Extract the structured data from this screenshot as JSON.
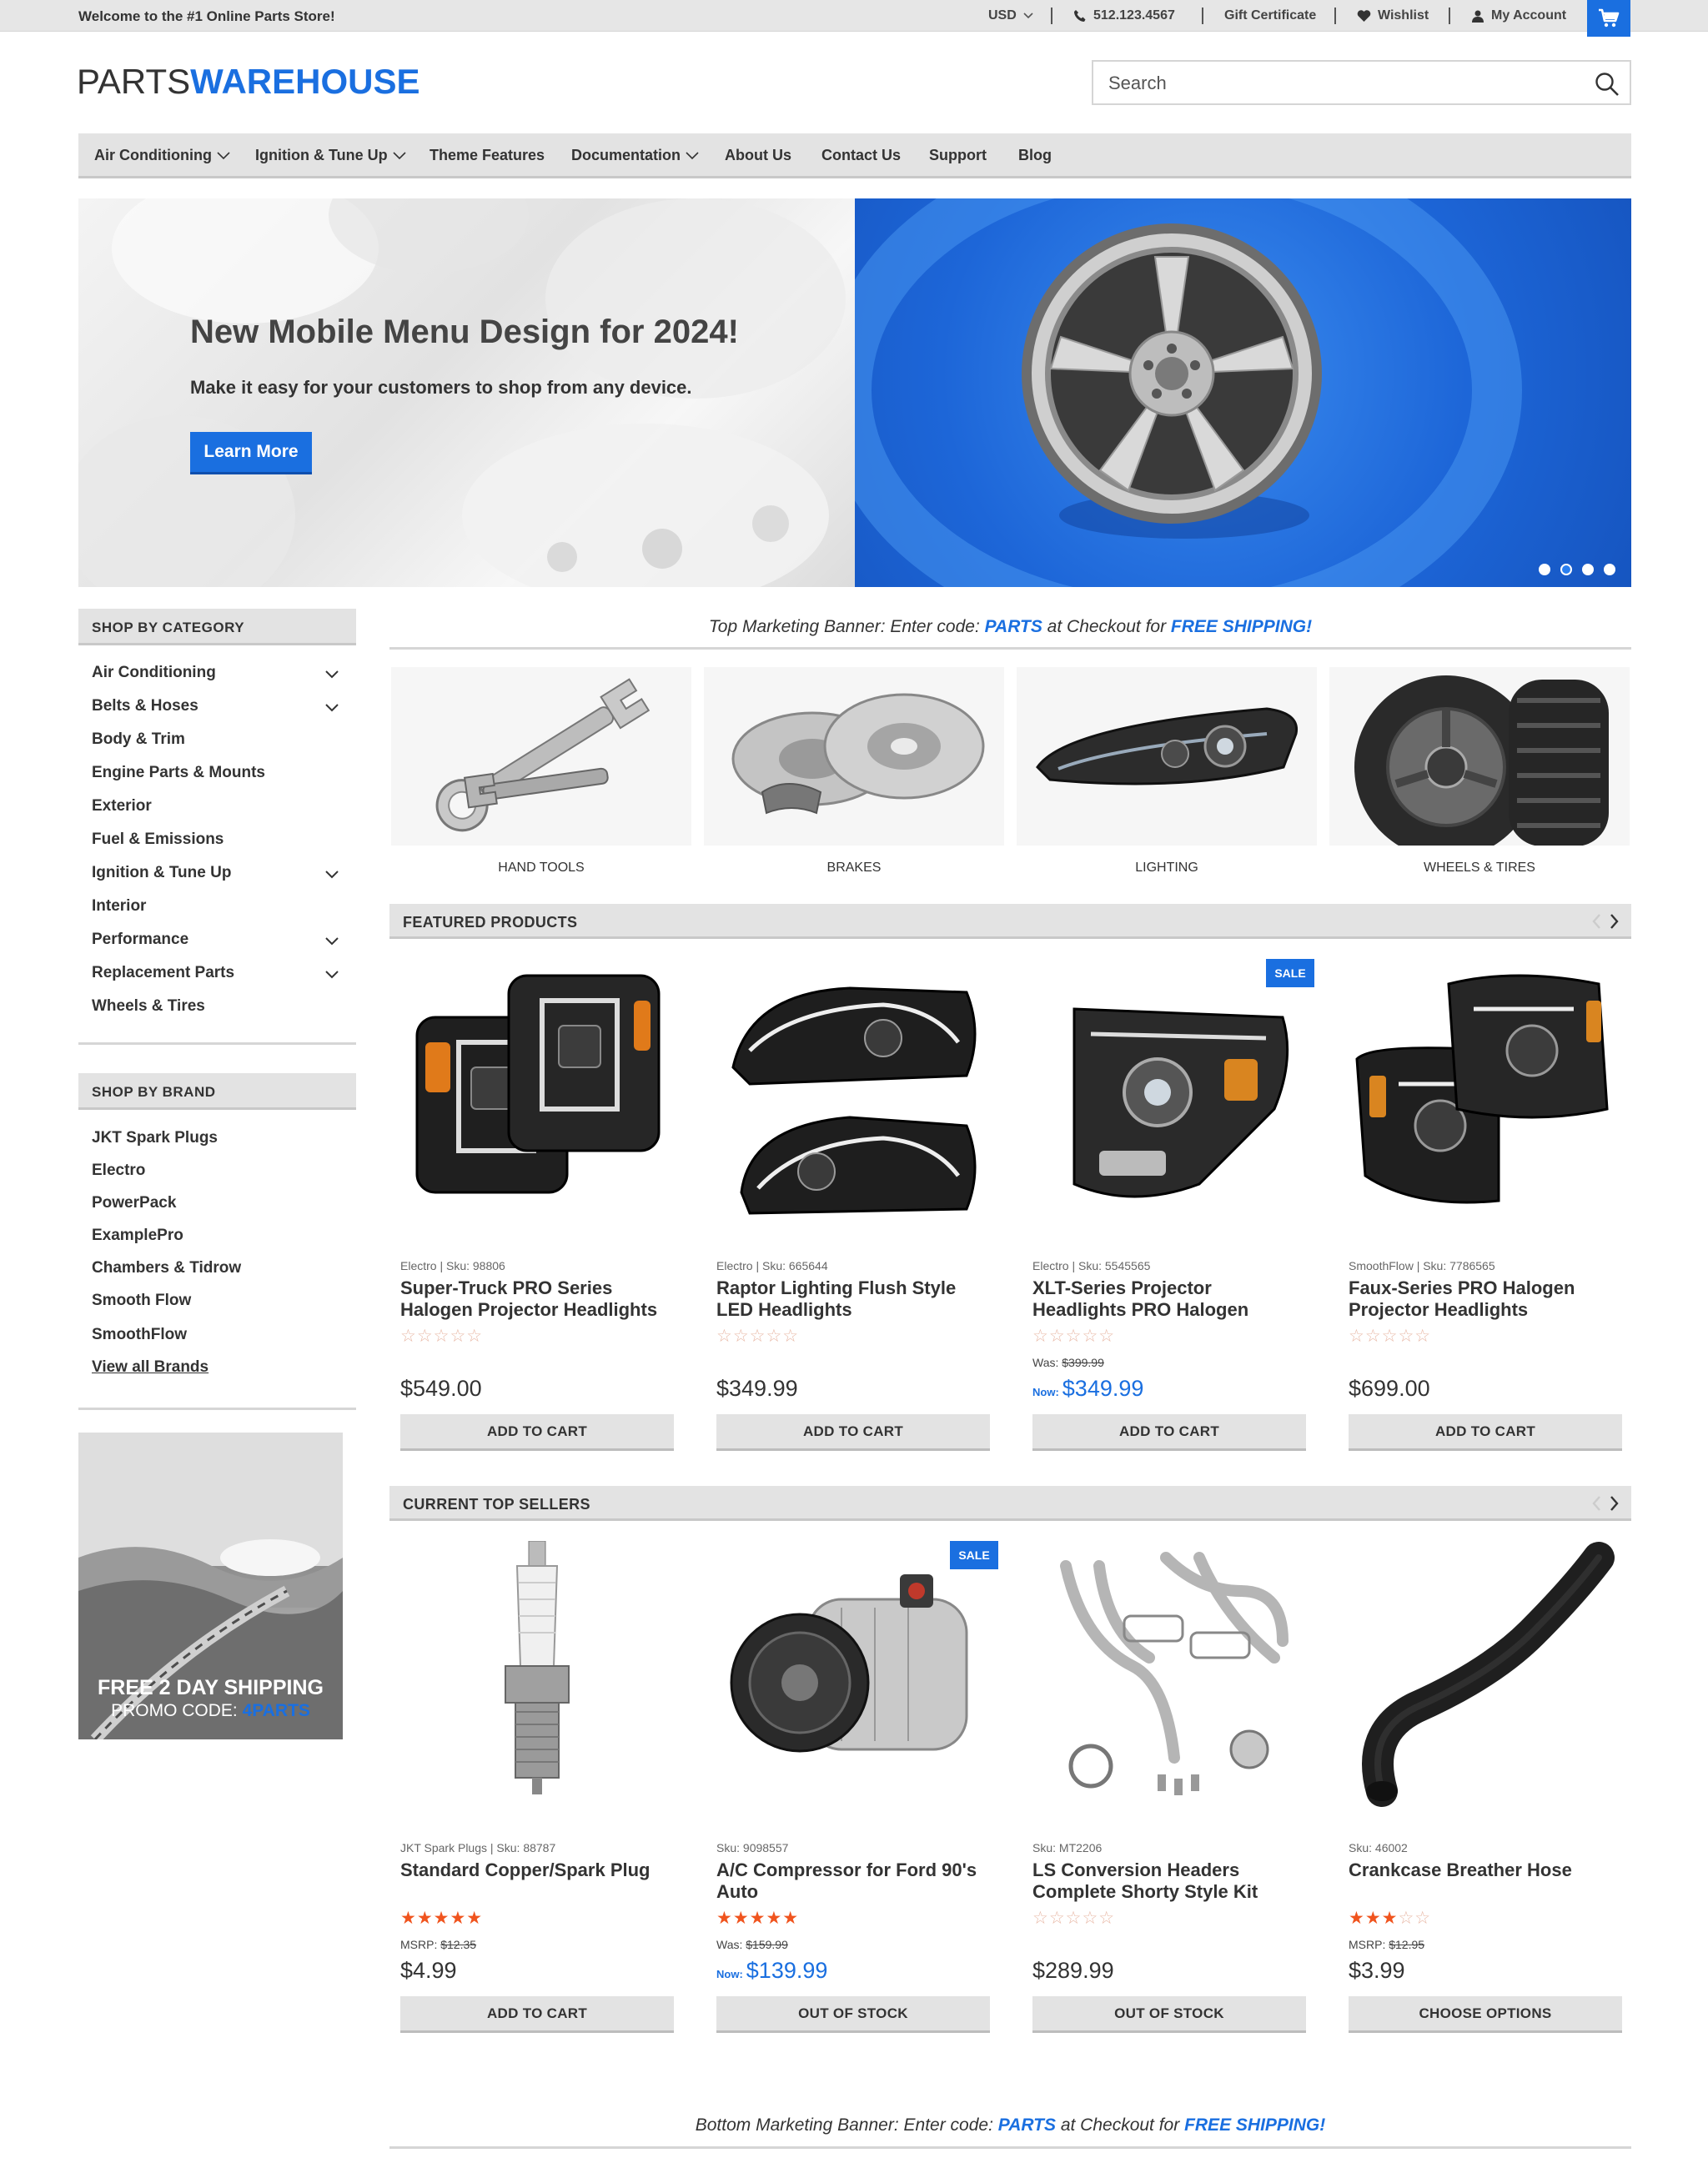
{
  "topbar": {
    "welcome": "Welcome to the #1 Online Parts Store!",
    "currency": "USD",
    "phone": "512.123.4567",
    "gift": "Gift Certificate",
    "wishlist": "Wishlist",
    "account": "My Account"
  },
  "header": {
    "logo_part1": "PARTS",
    "logo_part2": "WAREHOUSE",
    "search_placeholder": "Search"
  },
  "nav": {
    "items": [
      "Air Conditioning",
      "Ignition & Tune Up",
      "Theme Features",
      "Documentation",
      "About Us",
      "Contact Us",
      "Support",
      "Blog"
    ]
  },
  "hero": {
    "title": "New Mobile Menu Design for 2024!",
    "subtitle": "Make it easy for your customers to shop from any device.",
    "button": "Learn More"
  },
  "sidebar": {
    "category_title": "SHOP BY CATEGORY",
    "categories": [
      "Air Conditioning",
      "Belts & Hoses",
      "Body & Trim",
      "Engine Parts & Mounts",
      "Exterior",
      "Fuel & Emissions",
      "Ignition & Tune Up",
      "Interior",
      "Performance",
      "Replacement Parts",
      "Wheels & Tires"
    ],
    "brand_title": "SHOP BY BRAND",
    "brands": [
      "JKT Spark Plugs",
      "Electro",
      "PowerPack",
      "ExamplePro",
      "Chambers & Tidrow",
      "Smooth Flow",
      "SmoothFlow"
    ],
    "view_all": "View all Brands",
    "promo_line1": "FREE 2 DAY SHIPPING",
    "promo_line2_prefix": "PROMO CODE: ",
    "promo_code": "4PARTS"
  },
  "banners": {
    "top_prefix": "Top Marketing Banner: Enter code: ",
    "bottom_prefix": "Bottom Marketing Banner: Enter code: ",
    "code": "PARTS",
    "middle": " at Checkout for ",
    "free": "FREE SHIPPING!"
  },
  "categories": [
    "HAND TOOLS",
    "BRAKES",
    "LIGHTING",
    "WHEELS & TIRES"
  ],
  "featured": {
    "title": "FEATURED PRODUCTS",
    "products": [
      {
        "meta": "Electro  |  Sku: 98806",
        "name": "Super-Truck PRO Series Halogen Projector Headlights",
        "rating": 0,
        "price": "$549.00",
        "button": "ADD TO CART"
      },
      {
        "meta": "Electro  |  Sku: 665644",
        "name": "Raptor Lighting Flush Style LED Headlights",
        "rating": 0,
        "price": "$349.99",
        "button": "ADD TO CART"
      },
      {
        "meta": "Electro  |  Sku: 5545565",
        "name": "XLT-Series Projector Headlights PRO Halogen",
        "rating": 0,
        "was_label": "Was:",
        "was": "$399.99",
        "now": "Now:",
        "price": "$349.99",
        "badge": "SALE",
        "button": "ADD TO CART"
      },
      {
        "meta": "SmoothFlow  |  Sku: 7786565",
        "name": "Faux-Series PRO Halogen Projector Headlights",
        "rating": 0,
        "price": "$699.00",
        "button": "ADD TO CART"
      }
    ]
  },
  "top_sellers": {
    "title": "CURRENT TOP SELLERS",
    "products": [
      {
        "meta": "JKT Spark Plugs  |  Sku: 88787",
        "name": "Standard Copper/Spark Plug",
        "rating": 5,
        "was_label": "MSRP:",
        "was": "$12.35",
        "price": "$4.99",
        "button": "ADD TO CART"
      },
      {
        "meta": "Sku: 9098557",
        "name": "A/C Compressor for Ford 90's Auto",
        "rating": 5,
        "was_label": "Was:",
        "was": "$159.99",
        "now": "Now:",
        "price": "$139.99",
        "badge": "SALE",
        "button": "OUT OF STOCK"
      },
      {
        "meta": "Sku: MT2206",
        "name": "LS Conversion Headers Complete Shorty Style Kit",
        "rating": 0,
        "price": "$289.99",
        "button": "OUT OF STOCK"
      },
      {
        "meta": "Sku: 46002",
        "name": "Crankcase Breather Hose",
        "rating": 3,
        "was_label": "MSRP:",
        "was": "$12.95",
        "price": "$3.99",
        "button": "CHOOSE OPTIONS"
      }
    ]
  },
  "colors": {
    "accent": "#1a6fe0",
    "star": "#f0541e",
    "bar": "#e3e3e3"
  }
}
